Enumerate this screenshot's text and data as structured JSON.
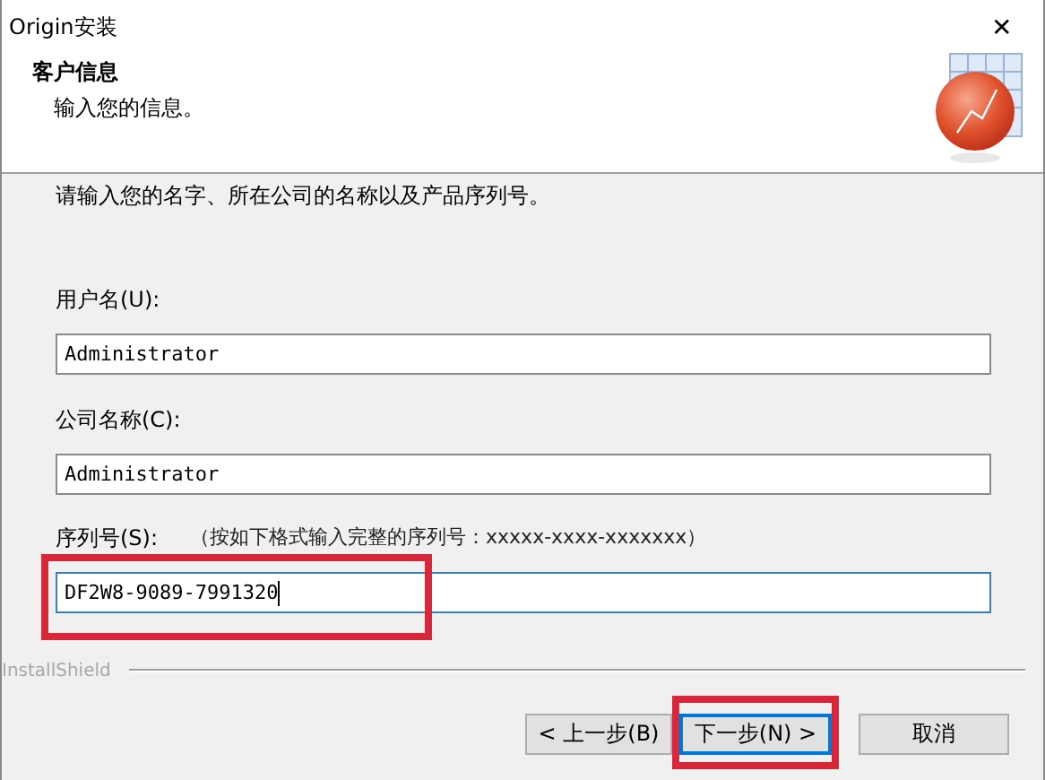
{
  "window": {
    "title": "Origin安装",
    "close": "✕"
  },
  "header": {
    "title": "客户信息",
    "subtitle": "输入您的信息。"
  },
  "instruction": "请输入您的名字、所在公司的名称以及产品序列号。",
  "fields": [
    {
      "label": "用户名(U):",
      "value": "Administrator",
      "focused": false,
      "highlighted": false
    },
    {
      "label": "公司名称(C):",
      "value": "Administrator",
      "focused": false,
      "highlighted": false
    },
    {
      "label": "序列号(S):",
      "hint": "（按如下格式输入完整的序列号：xxxxx-xxxx-xxxxxxx）",
      "value": "DF2W8-9089-7991320",
      "focused": true,
      "highlighted": true
    }
  ],
  "brand": "InstallShield",
  "buttons": [
    {
      "label": "< 上一步(B)",
      "kind": "back",
      "default": false,
      "highlighted": false
    },
    {
      "label": "下一步(N) >",
      "kind": "next",
      "default": true,
      "highlighted": true
    },
    {
      "label": "取消",
      "kind": "cancel",
      "default": false,
      "highlighted": false
    }
  ]
}
